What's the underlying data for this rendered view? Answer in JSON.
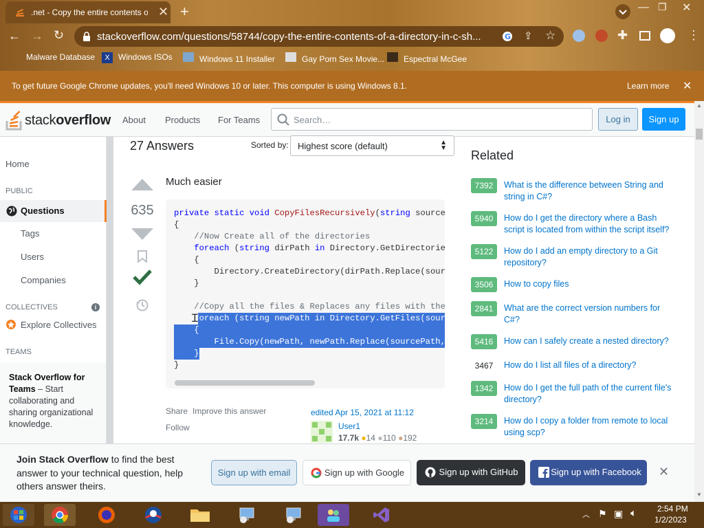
{
  "browser": {
    "tab_title": ".net - Copy the entire contents of",
    "url": "stackoverflow.com/questions/58744/copy-the-entire-contents-of-a-directory-in-c-sh...",
    "bookmarks": [
      "Malware Database",
      "Windows ISOs",
      "Windows 11 Installer",
      "Gay Porn Sex Movie...",
      "Espectral McGee"
    ],
    "infobar_text": "To get future Google Chrome updates, you'll need Windows 10 or later. This computer is using Windows 8.1.",
    "infobar_link": "Learn more"
  },
  "so_header": {
    "logo_light": "stack",
    "logo_bold": "overflow",
    "nav": [
      "About",
      "Products",
      "For Teams"
    ],
    "search_placeholder": "Search…",
    "login": "Log in",
    "signup": "Sign up"
  },
  "sidebar": {
    "home": "Home",
    "public": "PUBLIC",
    "questions": "Questions",
    "tags": "Tags",
    "users": "Users",
    "companies": "Companies",
    "collectives": "COLLECTIVES",
    "explore_collectives": "Explore Collectives",
    "teams": "TEAMS",
    "teams_title": "Stack Overflow for Teams",
    "teams_text": " – Start collaborating and sharing organizational knowledge."
  },
  "answers": {
    "count_label": "27 Answers",
    "sorted_label": "Sorted by:",
    "sort_value": "Highest score (default)",
    "score": "635",
    "intro": "Much easier",
    "share": "Share",
    "improve": "Improve this answer",
    "follow": "Follow",
    "edited": "edited Apr 15, 2021 at 11:12",
    "user_name": "User1",
    "user_rep": "17.7k",
    "gold": "14",
    "silver": "110",
    "bronze": "192"
  },
  "code_lines": [
    "private static void CopyFilesRecursively(string sourceP",
    "{",
    "    //Now Create all of the directories",
    "    foreach (string dirPath in Directory.GetDirectories",
    "    {",
    "        Directory.CreateDirectory(dirPath.Replace(sourc",
    "    }",
    "",
    "    //Copy all the files & Replaces any files with the",
    "    foreach (string newPath in Directory.GetFiles(sourc",
    "    {",
    "        File.Copy(newPath, newPath.Replace(sourcePath,",
    "    }",
    "}"
  ],
  "related": {
    "title": "Related",
    "items": [
      {
        "score": "7392",
        "q": "What is the difference between String and string in C#?",
        "accepted": true
      },
      {
        "score": "5940",
        "q": "How do I get the directory where a Bash script is located from within the script itself?",
        "accepted": true
      },
      {
        "score": "5122",
        "q": "How do I add an empty directory to a Git repository?",
        "accepted": true
      },
      {
        "score": "3506",
        "q": "How to copy files",
        "accepted": true
      },
      {
        "score": "2841",
        "q": "What are the correct version numbers for C#?",
        "accepted": true
      },
      {
        "score": "5416",
        "q": "How can I safely create a nested directory?",
        "accepted": true
      },
      {
        "score": "3467",
        "q": "How do I list all files of a directory?",
        "accepted": false
      },
      {
        "score": "1342",
        "q": "How do I get the full path of the current file's directory?",
        "accepted": true
      },
      {
        "score": "3214",
        "q": "How do I copy a folder from remote to local using scp?",
        "accepted": true
      }
    ]
  },
  "banner": {
    "bold": "Join Stack Overflow",
    "text": " to find the best answer to your technical question, help others answer theirs.",
    "email": "Sign up with email",
    "google": "Sign up with Google",
    "github": "Sign up with GitHub",
    "facebook": "Sign up with Facebook"
  },
  "taskbar": {
    "time": "2:54 PM",
    "date": "1/2/2023"
  },
  "colors": {
    "so_orange": "#f48225",
    "so_blue": "#0a95ff",
    "accepted_green": "#5eba7d",
    "infobar": "#b06d22"
  }
}
